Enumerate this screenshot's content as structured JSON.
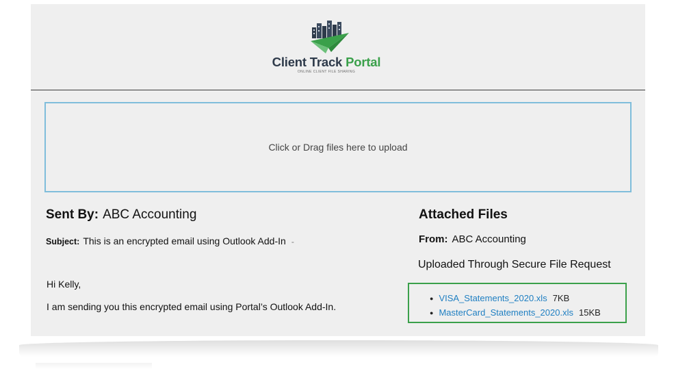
{
  "header": {
    "brand_main": "Client Track",
    "brand_accent": "Portal",
    "tagline": "ONLINE CLIENT FILE SHARING",
    "brand_color": "#2e3a4a",
    "accent_color": "#3aa04a"
  },
  "upload": {
    "prompt": "Click or Drag files here to upload",
    "border_color": "#7fbddb"
  },
  "message": {
    "sent_by_label": "Sent By:",
    "sent_by_value": "ABC Accounting",
    "subject_label": "Subject:",
    "subject_value": "This is an encrypted email using Outlook Add-In",
    "subject_tail": "-",
    "greeting": "Hi Kelly,",
    "body": "I am sending you this encrypted email using Portal’s Outlook Add-In."
  },
  "attachments": {
    "title": "Attached Files",
    "from_label": "From:",
    "from_value": "ABC Accounting",
    "source": "Uploaded Through Secure File Request",
    "box_color": "#3aa04a",
    "link_color": "#1f7fc2",
    "files": [
      {
        "name": "VISA_Statements_2020.xls",
        "size": "7KB"
      },
      {
        "name": "MasterCard_Statements_2020.xls",
        "size": "15KB"
      }
    ]
  }
}
